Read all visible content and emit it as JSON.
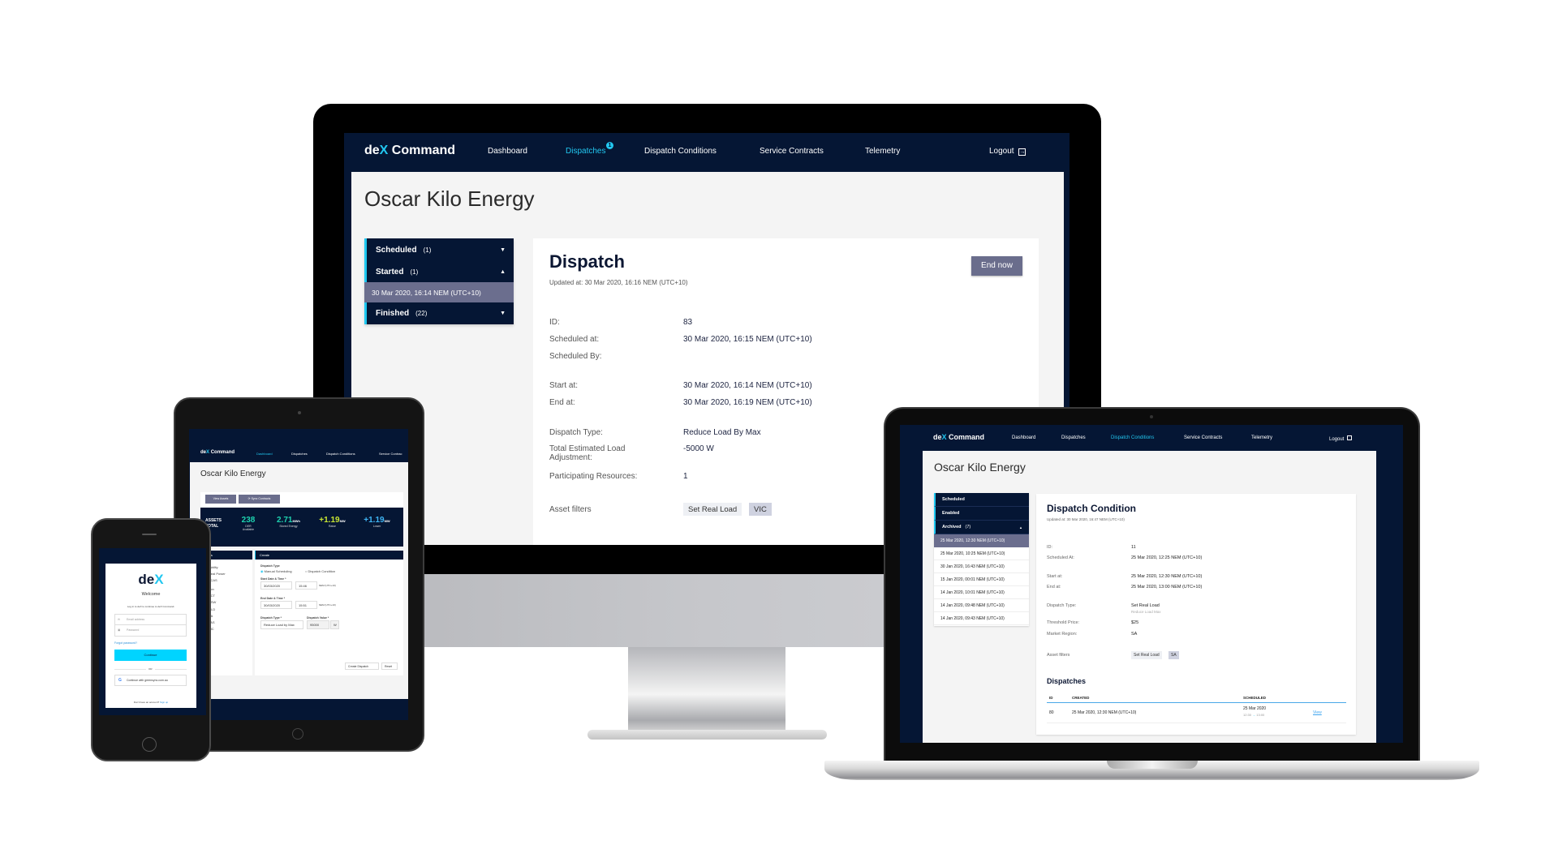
{
  "brand": {
    "logo_de": "de",
    "logo_x": "X",
    "logo_command": "Command",
    "accent": "#22c7f0",
    "navy": "#051634"
  },
  "monitor": {
    "nav": {
      "items": [
        "Dashboard",
        "Dispatches",
        "Dispatch Conditions",
        "Service Contracts",
        "Telemetry"
      ],
      "active": "Dispatches",
      "badge": "1",
      "logout": "Logout"
    },
    "org_title": "Oscar Kilo Energy",
    "sidebar": {
      "scheduled": {
        "label": "Scheduled",
        "count": "(1)"
      },
      "started": {
        "label": "Started",
        "count": "(1)"
      },
      "started_item": "30 Mar 2020, 16:14 NEM (UTC+10)",
      "finished": {
        "label": "Finished",
        "count": "(22)"
      }
    },
    "card": {
      "title": "Dispatch",
      "updated": "Updated at: 30 Mar 2020, 16:16 NEM (UTC+10)",
      "end_now": "End now",
      "fields": [
        {
          "label": "ID:",
          "value": "83"
        },
        {
          "label": "Scheduled at:",
          "value": "30 Mar 2020, 16:15 NEM (UTC+10)"
        },
        {
          "label": "Scheduled By:",
          "value": ""
        },
        {
          "label": "Start at:",
          "value": "30 Mar 2020, 16:14 NEM (UTC+10)"
        },
        {
          "label": "End at:",
          "value": "30 Mar 2020, 16:19 NEM (UTC+10)"
        },
        {
          "label": "Dispatch Type:",
          "value": "Reduce Load By Max"
        },
        {
          "label": "Total Estimated Load Adjustment:",
          "value": "-5000 W"
        },
        {
          "label": "Participating Resources:",
          "value": "1"
        }
      ],
      "asset_filters_label": "Asset filters",
      "chips": [
        "Set Real Load",
        "VIC"
      ]
    }
  },
  "laptop": {
    "nav": {
      "items": [
        "Dashboard",
        "Dispatches",
        "Dispatch Conditions",
        "Service Contracts",
        "Telemetry"
      ],
      "active": "Dispatch Conditions",
      "logout": "Logout"
    },
    "org_title": "Oscar Kilo Energy",
    "sidebar": {
      "groups": [
        "Scheduled",
        "Enabled",
        "Archived"
      ],
      "archived_count": "(7)",
      "dates": [
        "25 Mar 2020, 12:30 NEM (UTC+10)",
        "25 Mar 2020, 10:25 NEM (UTC+10)",
        "30 Jan 2020, 16:43 NEM (UTC+10)",
        "15 Jan 2020, 00:01 NEM (UTC+10)",
        "14 Jan 2020, 10:01 NEM (UTC+10)",
        "14 Jan 2020, 09:48 NEM (UTC+10)",
        "14 Jan 2020, 09:43 NEM (UTC+10)"
      ]
    },
    "card": {
      "title": "Dispatch Condition",
      "updated": "Updated at: 30 Mar 2020, 16:47 NEM (UTC+10)",
      "fields": [
        {
          "label": "ID:",
          "value": "11"
        },
        {
          "label": "Scheduled At:",
          "value": "25 Mar 2020, 12:25 NEM (UTC+10)"
        },
        {
          "label": "Start at:",
          "value": "25 Mar 2020, 12:30 NEM (UTC+10)"
        },
        {
          "label": "End at:",
          "value": "25 Mar 2020, 13:00 NEM (UTC+10)"
        },
        {
          "label": "Dispatch Type:",
          "value": "Set Real Load",
          "sub": "Reduce Load Max"
        },
        {
          "label": "Threshold Price:",
          "value": "$25"
        },
        {
          "label": "Market Region:",
          "value": "SA"
        }
      ],
      "asset_filters_label": "Asset filters",
      "chips": [
        "Set Real Load",
        "SA"
      ],
      "dispatches_title": "Dispatches",
      "table": {
        "headers": [
          "ID",
          "CREATED",
          "SCHEDULED"
        ],
        "rows": [
          {
            "id": "80",
            "created": "25 Mar 2020, 12:30 NEM (UTC+10)",
            "scheduled_date": "25 Mar 2020",
            "scheduled_start": "12:30",
            "scheduled_end": "13:00",
            "link": "View"
          }
        ]
      }
    }
  },
  "tablet": {
    "nav": {
      "items": [
        "Dashboard",
        "Dispatches",
        "Dispatch Conditions",
        "Service Contrac"
      ],
      "active": "Dashboard"
    },
    "org_title": "Oscar Kilo Energy",
    "buttons": [
      "View Assets",
      "Sync Contracts"
    ],
    "stats": {
      "assets_label": "ASSETS TOTAL",
      "items": [
        {
          "value": "238",
          "unit": "",
          "label": "DER Available",
          "color": "#1ed3b0"
        },
        {
          "value": "2.71",
          "unit": "MWh",
          "label": "Stored Energy",
          "color": "#1ed3b0"
        },
        {
          "value": "+1.19",
          "unit": "MW",
          "label": "Raise",
          "color": "#c8e632"
        },
        {
          "value": "+1.19",
          "unit": "MW",
          "label": "Lower",
          "color": "#3fb6f5"
        }
      ]
    },
    "filters": {
      "title": "Filters",
      "capability_label": "Capability",
      "capabilities": [
        "Real Power",
        "FCAS"
      ],
      "region_label": "Region",
      "regions": [
        "ACT",
        "NSW",
        "QLD",
        "SA",
        "TAS",
        "VIC"
      ]
    },
    "create": {
      "title": "Create",
      "dispatch_type_label": "Dispatch Type",
      "radio_manual": "Manual Scheduling",
      "radio_condition": "Dispatch Condition",
      "start_label": "Start Date & Time *",
      "start_date": "30/03/2020",
      "start_time": "15:46",
      "end_label": "End Date & Time *",
      "end_date": "30/03/2020",
      "end_time": "15:51",
      "tz": "NEM (UTC+10)",
      "type_label": "Dispatch Type *",
      "type_value": "Reduce Load by Max",
      "value_label": "Dispatch Value *",
      "value": "95000",
      "unit": "W",
      "create_button": "Create Dispatch",
      "reset_button": "Reset"
    }
  },
  "phone": {
    "logo_de": "de",
    "logo_x": "X",
    "welcome": "Welcome",
    "subtitle": "Log in to deX to continue to deX Command.",
    "email_placeholder": "Email address",
    "password_placeholder": "Password",
    "forgot": "Forgot password?",
    "continue": "Continue",
    "or": "OR",
    "google": "Continue with greensync.com.au",
    "footer": "Don't have an account?",
    "signup": "Sign up",
    "continue_color": "#00d4ff"
  }
}
